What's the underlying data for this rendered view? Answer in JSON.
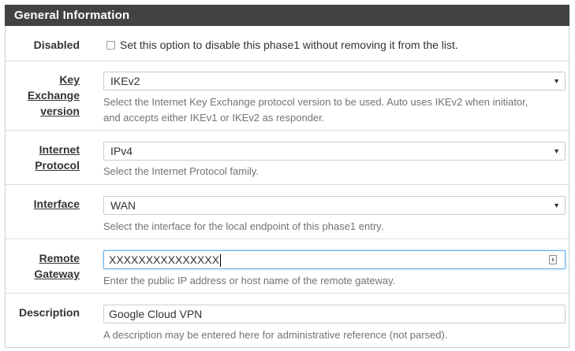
{
  "section": {
    "title": "General Information"
  },
  "fields": {
    "disabled": {
      "label": "Disabled",
      "checkbox_text": "Set this option to disable this phase1 without removing it from the list.",
      "checked": false
    },
    "key_exchange": {
      "label_line1": "Key Exchange",
      "label_line2": "version",
      "value": "IKEv2",
      "help_line1": "Select the Internet Key Exchange protocol version to be used. Auto uses IKEv2 when initiator,",
      "help_line2": "and accepts either IKEv1 or IKEv2 as responder."
    },
    "internet_protocol": {
      "label_line1": "Internet",
      "label_line2": "Protocol",
      "value": "IPv4",
      "help": "Select the Internet Protocol family."
    },
    "interface": {
      "label": "Interface",
      "value": "WAN",
      "help": "Select the interface for the local endpoint of this phase1 entry."
    },
    "remote_gateway": {
      "label_line1": "Remote",
      "label_line2": "Gateway",
      "value": "XXXXXXXXXXXXXXX",
      "help": "Enter the public IP address or host name of the remote gateway."
    },
    "description": {
      "label": "Description",
      "value": "Google Cloud VPN",
      "help": "A description may be entered here for administrative reference (not parsed)."
    }
  },
  "icons": {
    "select_caret": "caret-down-icon",
    "key_icon": "password-manager-icon"
  }
}
